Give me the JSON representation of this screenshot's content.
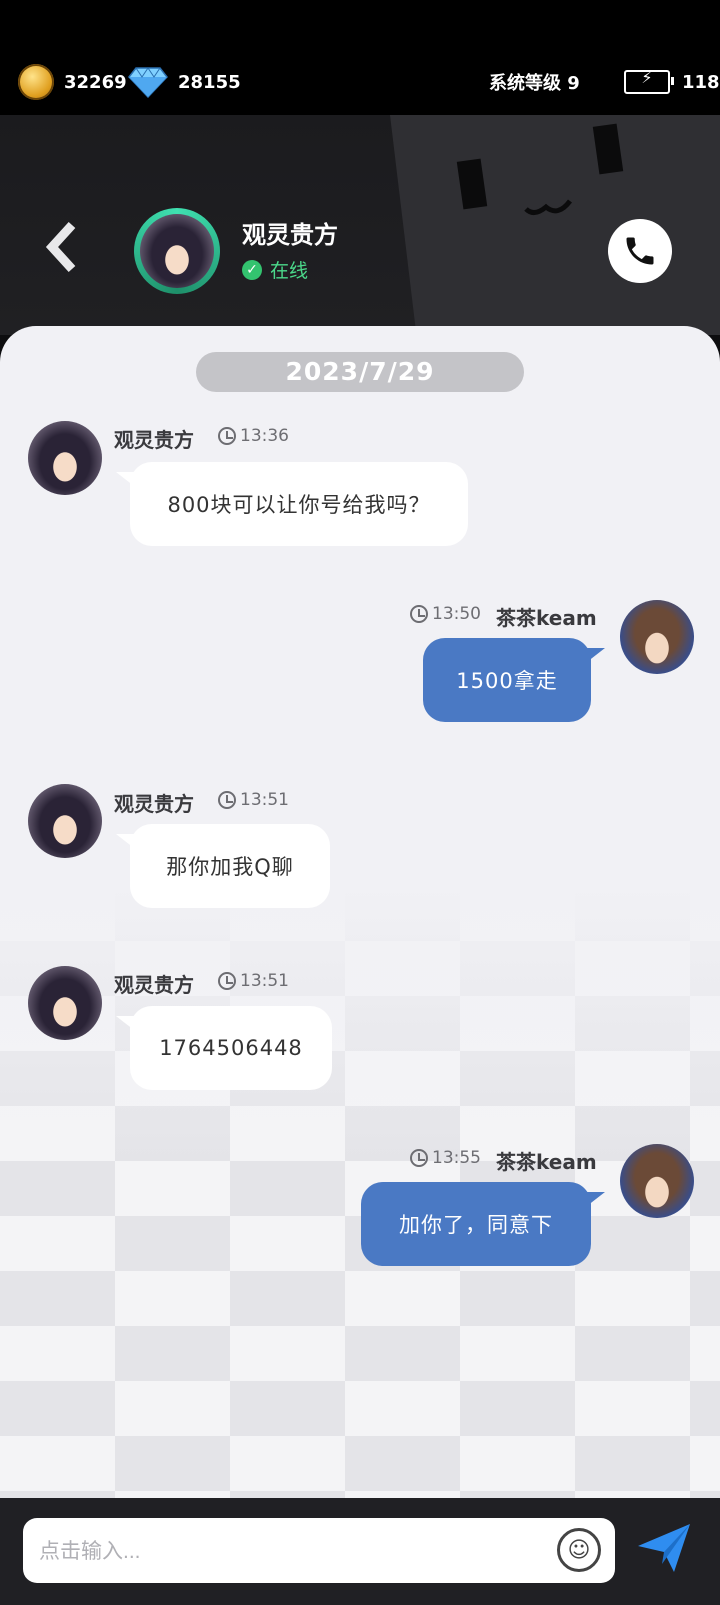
{
  "status": {
    "coins": "32269",
    "gems": "28155",
    "system_level": "系统等级 9",
    "energy": "118"
  },
  "contact": {
    "name": "观灵贵方",
    "status": "在线"
  },
  "date_label": "2023/7/29",
  "messages": [
    {
      "sender": "观灵贵方",
      "time": "13:36",
      "text": "800块可以让你号给我吗？",
      "side": "left"
    },
    {
      "sender": "茶茶keam",
      "time": "13:50",
      "text": "1500拿走",
      "side": "right"
    },
    {
      "sender": "观灵贵方",
      "time": "13:51",
      "text": "那你加我Q聊",
      "side": "left"
    },
    {
      "sender": "观灵贵方",
      "time": "13:51",
      "text": "1764506448",
      "side": "left"
    },
    {
      "sender": "茶茶keam",
      "time": "13:55",
      "text": "加你了，同意下",
      "side": "right"
    }
  ],
  "input": {
    "placeholder": "点击输入..."
  },
  "colors": {
    "accent": "#4a79c4",
    "online": "#33c36f"
  }
}
